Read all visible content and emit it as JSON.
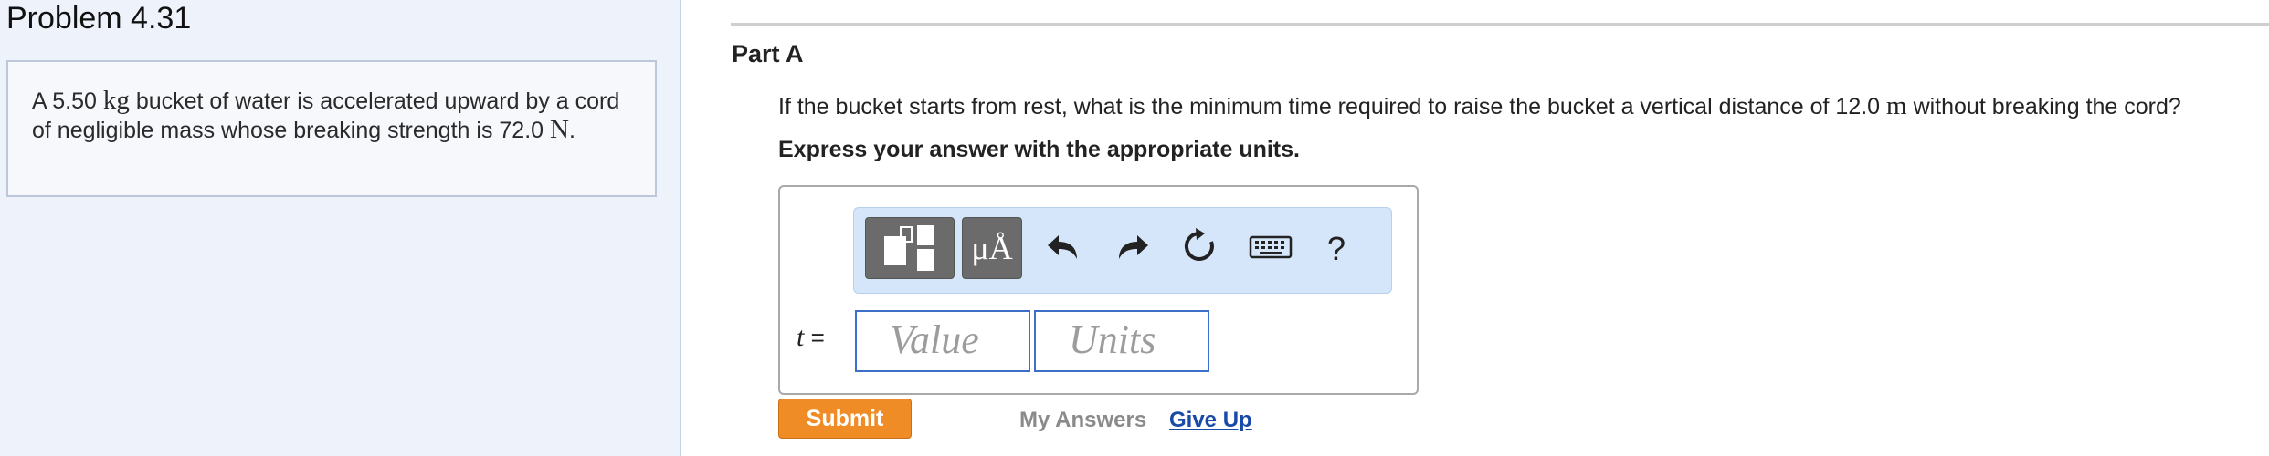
{
  "problem": {
    "title": "Problem 4.31",
    "statement": {
      "part1": "A 5.50",
      "mass_unit": "kg",
      "part2": "bucket of water is accelerated upward by a cord of negligible mass whose breaking strength is 72.0",
      "force_unit": "N",
      "part3": "."
    }
  },
  "part": {
    "title": "Part A",
    "question": {
      "part1": "If the bucket starts from rest, what is the minimum time required to raise the bucket a vertical distance of 12.0",
      "unit": "m",
      "part2": "without breaking the cord?"
    },
    "instruction": "Express your answer with the appropriate units."
  },
  "toolbar": {
    "templates_icon": "templates-icon",
    "units_label": "μÅ",
    "undo_icon": "undo-icon",
    "redo_icon": "redo-icon",
    "reset_icon": "reset-icon",
    "keyboard_icon": "keyboard-icon",
    "help_label": "?"
  },
  "answer": {
    "variable": "t",
    "equals": "=",
    "value_placeholder": "Value",
    "units_placeholder": "Units"
  },
  "actions": {
    "submit_label": "Submit",
    "my_answers_label": "My Answers",
    "give_up_label": "Give Up"
  },
  "colors": {
    "left_pane_bg": "#eef3fb",
    "submit_bg": "#f08c25",
    "link": "#1a4aa8",
    "toolbar_bg": "#d5e6fb",
    "input_border": "#3c70c8"
  }
}
